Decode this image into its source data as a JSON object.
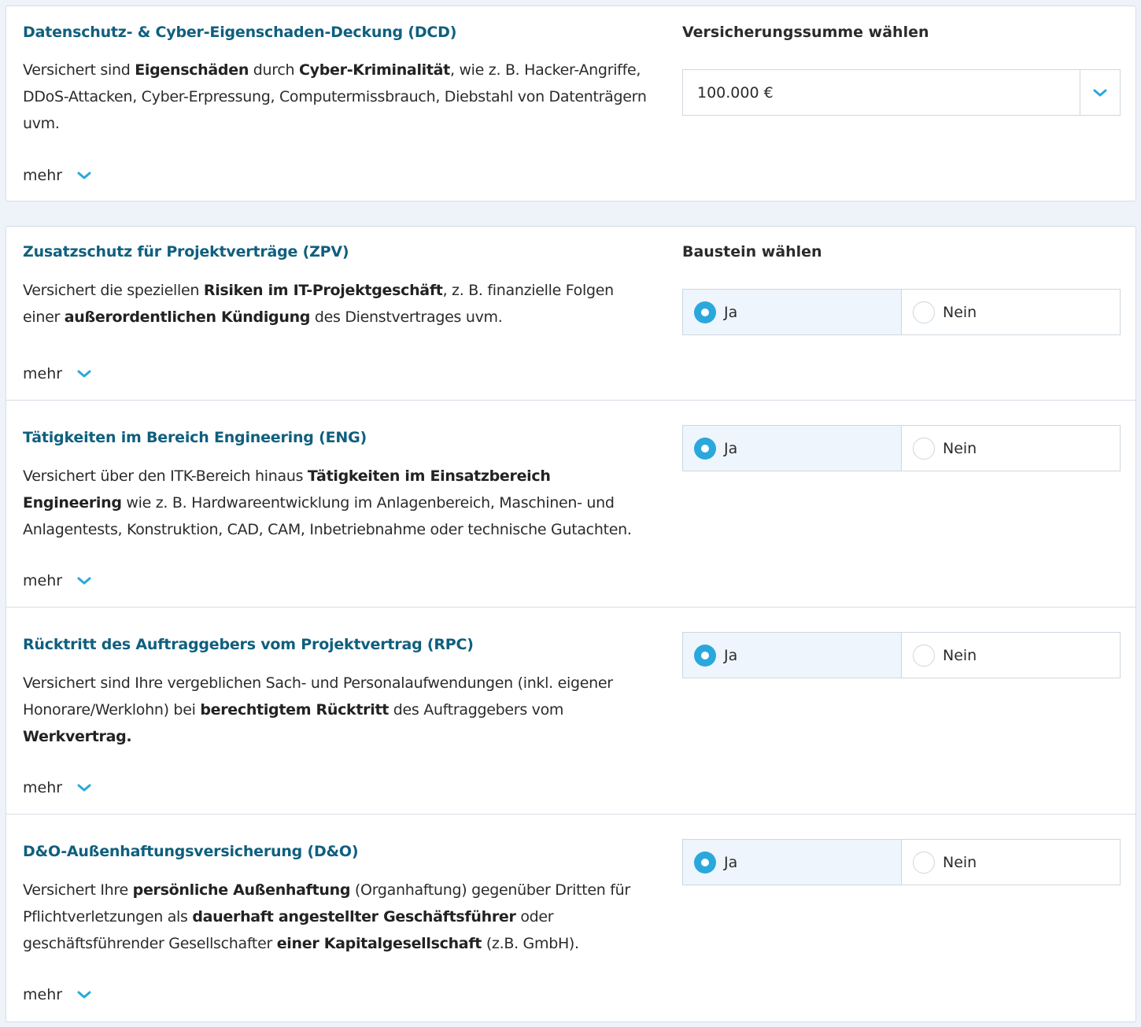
{
  "colors": {
    "accent": "#2aa8dc",
    "title": "#0f5f7e",
    "selected_bg": "#eef5fd",
    "page_bg": "#eef3fa"
  },
  "dcd": {
    "title": "Datenschutz- & Cyber-Eigenschaden-Deckung (DCD)",
    "desc": [
      {
        "t": "Versichert sind ",
        "b": false
      },
      {
        "t": "Eigenschäden",
        "b": true
      },
      {
        "t": " durch ",
        "b": false
      },
      {
        "t": "Cyber-Kriminalität",
        "b": true
      },
      {
        "t": ", wie z. B. Hacker-Angriffe, DDoS-Attacken, Cyber-Erpressung, Computermissbrauch, Diebstahl von Datenträgern uvm.",
        "b": false
      }
    ],
    "more_label": "mehr",
    "sum_label": "Versicherungssumme wählen",
    "sum_value": "100.000 €",
    "dropdown_icon": "chevron-down-icon"
  },
  "baustein_label": "Baustein wählen",
  "option_yes": "Ja",
  "option_no": "Nein",
  "modules": [
    {
      "key": "zpv",
      "title": "Zusatzschutz für Projektverträge (ZPV)",
      "desc": [
        {
          "t": "Versichert die speziellen ",
          "b": false
        },
        {
          "t": "Risiken im IT-Projektgeschäft",
          "b": true
        },
        {
          "t": ", z. B. finanzielle Folgen einer ",
          "b": false
        },
        {
          "t": "außerordentlichen Kündigung",
          "b": true
        },
        {
          "t": " des Dienstvertrages uvm.",
          "b": false
        }
      ],
      "more_label": "mehr",
      "selected": "Ja"
    },
    {
      "key": "eng",
      "title": "Tätigkeiten im Bereich Engineering (ENG)",
      "desc": [
        {
          "t": "Versichert über den ITK-Bereich hinaus ",
          "b": false
        },
        {
          "t": "Tätigkeiten im Einsatzbereich Engineering",
          "b": true
        },
        {
          "t": " wie z. B. Hardwareentwicklung im Anlagenbereich, Maschinen- und Anlagentests, Konstruktion, CAD, CAM, Inbetriebnahme oder technische Gutachten.",
          "b": false
        }
      ],
      "more_label": "mehr",
      "selected": "Ja"
    },
    {
      "key": "rpc",
      "title": "Rücktritt des Auftraggebers vom Projektvertrag (RPC)",
      "desc": [
        {
          "t": "Versichert sind Ihre vergeblichen Sach- und Personalaufwendungen (inkl. eigener Honorare/Werklohn) bei ",
          "b": false
        },
        {
          "t": "berechtigtem Rücktritt",
          "b": true
        },
        {
          "t": " des Auftraggebers vom ",
          "b": false
        },
        {
          "t": "Werkvertrag.",
          "b": true
        }
      ],
      "more_label": "mehr",
      "selected": "Ja"
    },
    {
      "key": "do",
      "title": "D&O-Außenhaftungsversicherung (D&O)",
      "desc": [
        {
          "t": "Versichert Ihre ",
          "b": false
        },
        {
          "t": "persönliche Außenhaftung",
          "b": true
        },
        {
          "t": " (Organhaftung) gegenüber Dritten für Pflichtverletzungen als ",
          "b": false
        },
        {
          "t": "dauerhaft angestellter Geschäftsführer",
          "b": true
        },
        {
          "t": " oder geschäftsführender Gesellschafter ",
          "b": false
        },
        {
          "t": "einer Kapitalgesellschaft",
          "b": true
        },
        {
          "t": " (z.B. GmbH).",
          "b": false
        }
      ],
      "more_label": "mehr",
      "selected": "Ja"
    }
  ]
}
